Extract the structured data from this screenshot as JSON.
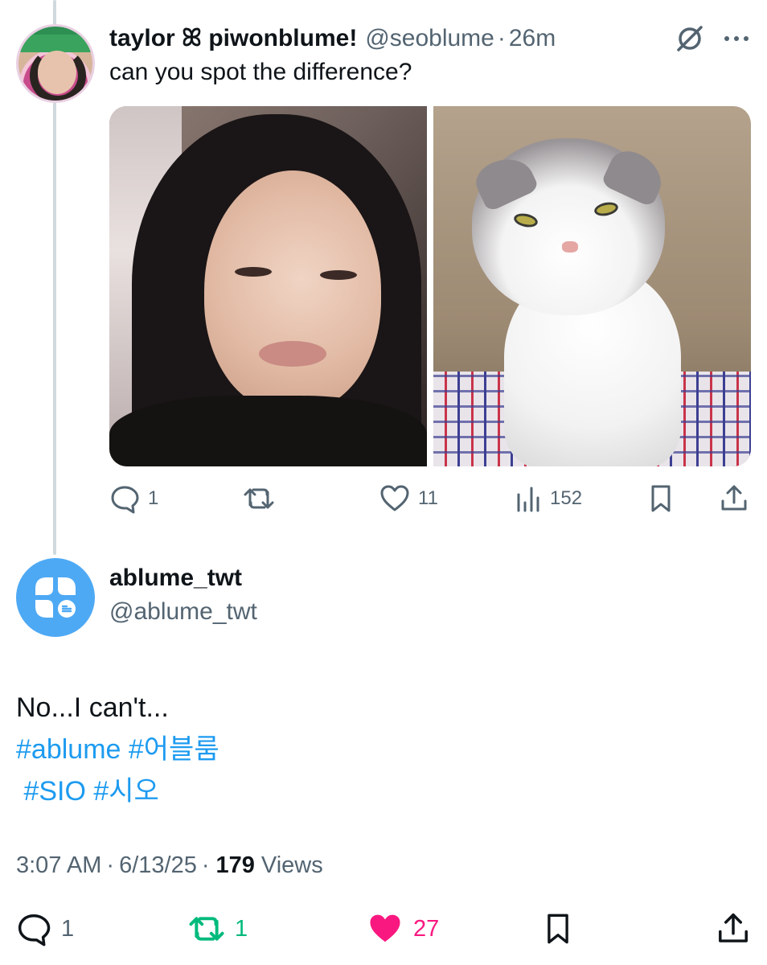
{
  "parent_tweet": {
    "display_name": "taylor ꕤ piwonblume!",
    "handle": "@seoblume",
    "separator": "·",
    "time": "26m",
    "text": "can you spot the difference?",
    "media": [
      "photo-woman",
      "photo-cat"
    ],
    "actions": {
      "replies": "1",
      "retweets": "",
      "likes": "11",
      "views": "152"
    }
  },
  "main_tweet": {
    "display_name": "ablume_twt",
    "handle": "@ablume_twt",
    "text_line1": "No...I can't...",
    "tags_line1": "#ablume #어블룸",
    "tags_line2": " #SIO #시오",
    "time": "3:07 AM",
    "sep1": "·",
    "date": "6/13/25",
    "sep2": "·",
    "views_count": "179",
    "views_label": "Views",
    "actions": {
      "replies": "1",
      "retweets": "1",
      "likes": "27"
    }
  },
  "colors": {
    "link": "#1d9bf0",
    "muted": "#536471",
    "retweet_active": "#00ba7c",
    "like_active": "#f91880"
  },
  "icons": [
    "grok-icon",
    "more-icon",
    "reply-icon",
    "retweet-icon",
    "like-icon",
    "views-icon",
    "bookmark-icon",
    "share-icon"
  ]
}
